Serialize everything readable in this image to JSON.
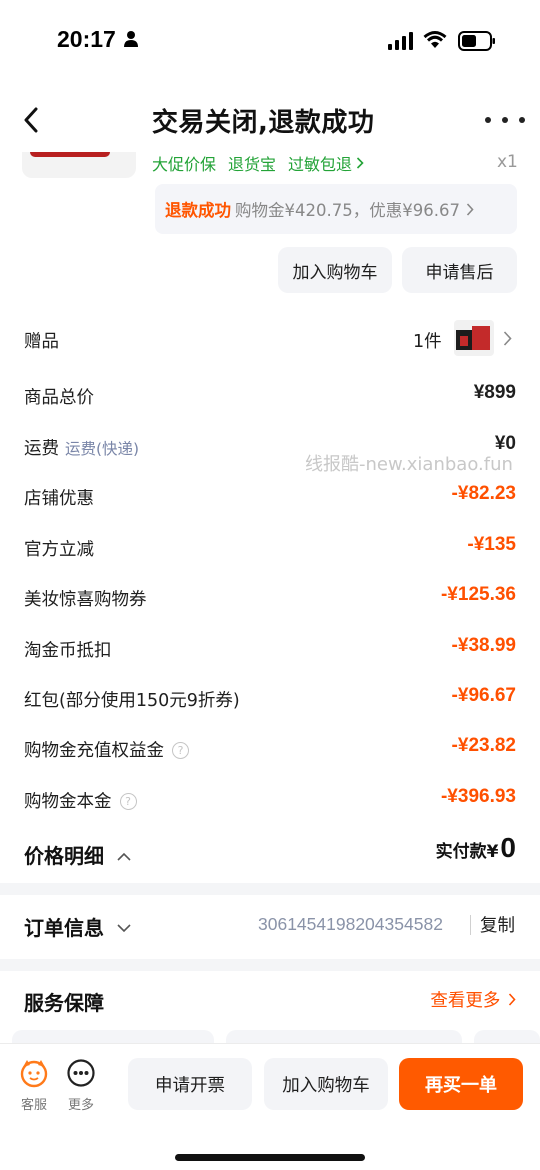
{
  "status_bar": {
    "time": "20:17"
  },
  "nav": {
    "title": "交易关闭,退款成功"
  },
  "product": {
    "tags": [
      "大促价保",
      "退货宝",
      "过敏包退"
    ],
    "quantity": "x1"
  },
  "refund": {
    "status": "退款成功",
    "detail": "购物金¥420.75，优惠¥96.67"
  },
  "actions": {
    "add_cart": "加入购物车",
    "after_sale": "申请售后"
  },
  "price_rows": {
    "gift": {
      "label": "赠品",
      "count": "1件"
    },
    "total": {
      "label": "商品总价",
      "value": "¥899"
    },
    "shipping": {
      "label": "运费",
      "sub": "运费(快递)",
      "value": "¥0"
    },
    "store_discount": {
      "label": "店铺优惠",
      "value": "-¥82.23"
    },
    "official_reduce": {
      "label": "官方立减",
      "value": "-¥135"
    },
    "beauty_coupon": {
      "label": "美妆惊喜购物券",
      "value": "-¥125.36"
    },
    "coin_deduct": {
      "label": "淘金币抵扣",
      "value": "-¥38.99"
    },
    "red_packet": {
      "label": "红包(部分使用150元9折券)",
      "value": "-¥96.67"
    },
    "shopping_gold_benefit": {
      "label": "购物金充值权益金",
      "value": "-¥23.82"
    },
    "shopping_gold_principal": {
      "label": "购物金本金",
      "value": "-¥396.93"
    }
  },
  "watermark": "线报酷-new.xianbao.fun",
  "summary": {
    "title": "价格明细",
    "paid_label": "实付款¥",
    "paid_amount": "0"
  },
  "order_info": {
    "title": "订单信息",
    "number": "3061454198204354582",
    "copy_label": "复制"
  },
  "service": {
    "title": "服务保障",
    "more_label": "查看更多"
  },
  "bottom_bar": {
    "service_label": "客服",
    "more_label": "更多",
    "invoice_label": "申请开票",
    "add_cart_label": "加入购物车",
    "rebuy_label": "再买一单"
  },
  "colors": {
    "accent": "#ff5000",
    "green": "#23a337",
    "muted_blue": "#7a86a8"
  }
}
